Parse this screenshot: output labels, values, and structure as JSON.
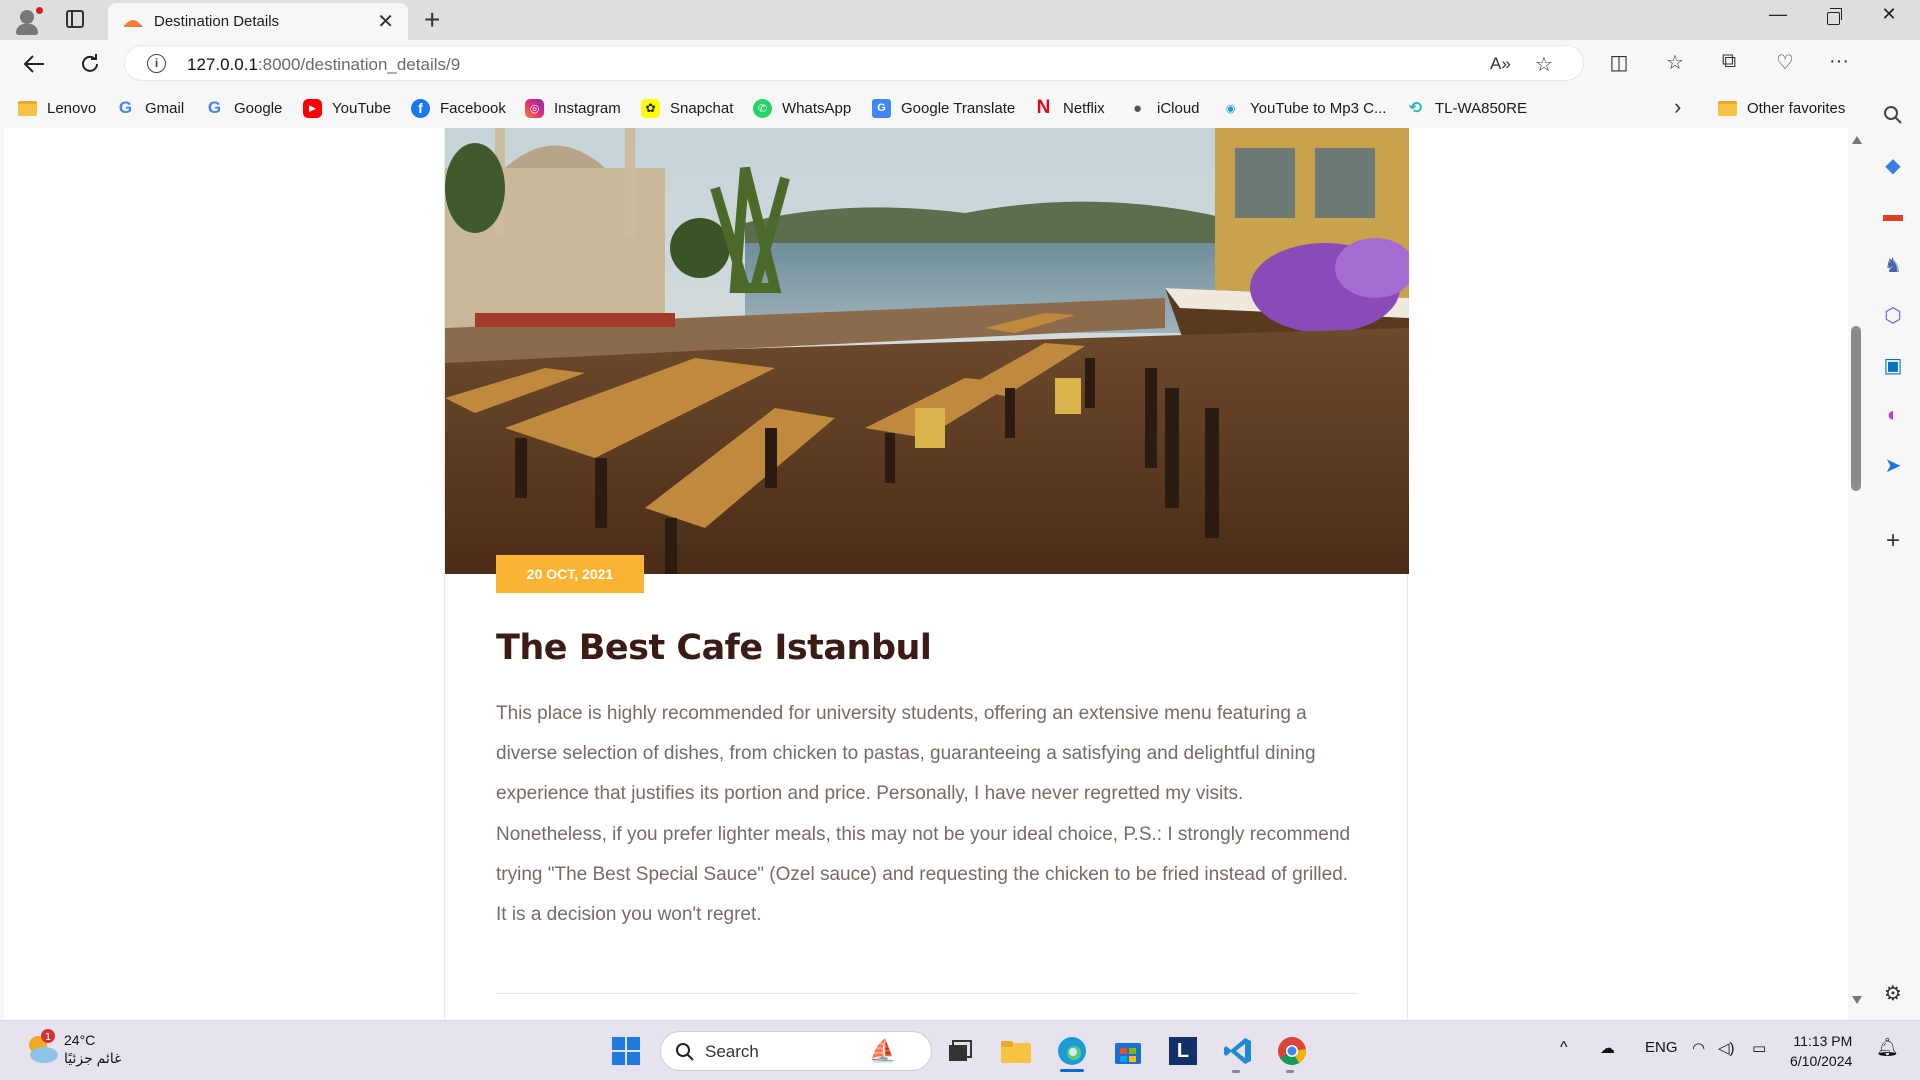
{
  "browser": {
    "tab_title": "Destination Details",
    "url_host": "127.0.0.1",
    "url_path": ":8000/destination_details/9",
    "window_min": "—",
    "window_close": "✕",
    "new_tab": "+",
    "tab_close": "✕"
  },
  "favorites": [
    {
      "label": "Lenovo",
      "icon": "folder-icon"
    },
    {
      "label": "Gmail",
      "icon": "google-g-icon"
    },
    {
      "label": "Google",
      "icon": "google-g-icon"
    },
    {
      "label": "YouTube",
      "icon": "youtube-icon"
    },
    {
      "label": "Facebook",
      "icon": "facebook-icon"
    },
    {
      "label": "Instagram",
      "icon": "instagram-icon"
    },
    {
      "label": "Snapchat",
      "icon": "snapchat-icon"
    },
    {
      "label": "WhatsApp",
      "icon": "whatsapp-icon"
    },
    {
      "label": "Google Translate",
      "icon": "translate-icon"
    },
    {
      "label": "Netflix",
      "icon": "netflix-icon"
    },
    {
      "label": "iCloud",
      "icon": "apple-icon"
    },
    {
      "label": "YouTube to Mp3 C...",
      "icon": "mp3-icon"
    },
    {
      "label": "TL-WA850RE",
      "icon": "tplink-icon"
    }
  ],
  "other_favorites": "Other favorites",
  "post": {
    "date": "20 OCT, 2021",
    "title": "The Best Cafe Istanbul",
    "body": "This place is highly recommended for university students, offering an extensive menu featuring a diverse selection of dishes, from chicken to pastas, guaranteeing a satisfying and delightful dining experience that justifies its portion and price. Personally, I have never regretted my visits. Nonetheless, if you prefer lighter meals, this may not be your ideal choice, P.S.: I strongly recommend trying \"The Best Special Sauce\" (Ozel sauce) and requesting the chicken to be fried instead of grilled. It is a decision you won't regret."
  },
  "taskbar": {
    "weather_temp": "24°C",
    "weather_desc": "غائم جزئيًا",
    "weather_badge": "1",
    "search_label": "Search",
    "language": "ENG",
    "time": "11:13 PM",
    "date": "6/10/2024"
  },
  "colors": {
    "accent_badge": "#fbb333",
    "title_color": "#3a1c14",
    "body_color": "#7b6a62"
  }
}
